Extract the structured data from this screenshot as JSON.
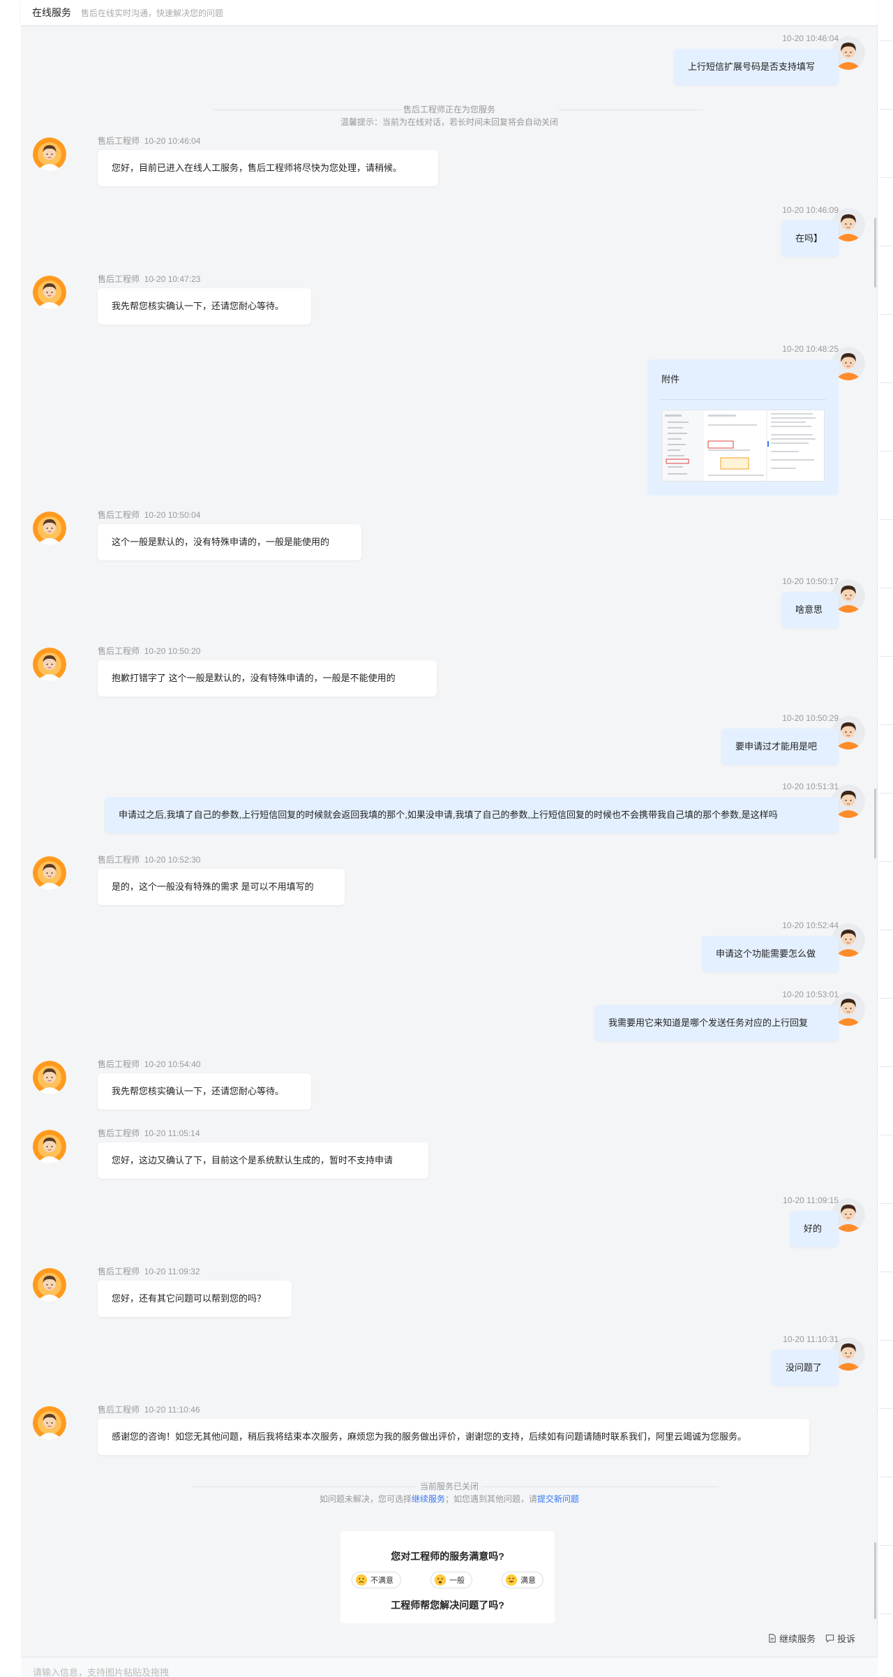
{
  "header": {
    "title": "在线服务",
    "subtitle": "售后在线实时沟通，快速解决您的问题"
  },
  "notices": {
    "start_title": "售后工程师正在为您服务",
    "start_tip": "温馨提示：当前为在线对话，若长时间未回复将会自动关闭",
    "closed_title": "当前服务已关闭",
    "closed_prefix": "如问题未解决，您可选择",
    "continue_link": "继续服务",
    "closed_mid": "；如您遇到其他问题，请",
    "new_issue_link": "提交新问题"
  },
  "agent_name": "售后工程师",
  "attachment_label": "附件",
  "messages": [
    {
      "who": "user",
      "time": "10-20 10:46:04",
      "text": "上行短信扩展号码是否支持填写"
    },
    {
      "who": "agent",
      "time": "10-20 10:46:04",
      "text": "您好，目前已进入在线人工服务，售后工程师将尽快为您处理，请稍候。"
    },
    {
      "who": "user",
      "time": "10-20 10:46:09",
      "text": "在吗】"
    },
    {
      "who": "agent",
      "time": "10-20 10:47:23",
      "text": "我先帮您核实确认一下，还请您耐心等待。"
    },
    {
      "who": "user",
      "time": "10-20 10:48:25",
      "text": ""
    },
    {
      "who": "agent",
      "time": "10-20 10:50:04",
      "text": "这个一般是默认的，没有特殊申请的，一般是能使用的"
    },
    {
      "who": "user",
      "time": "10-20 10:50:17",
      "text": "啥意思"
    },
    {
      "who": "agent",
      "time": "10-20 10:50:20",
      "text": "抱歉打错字了   这个一般是默认的，没有特殊申请的，一般是不能使用的"
    },
    {
      "who": "user",
      "time": "10-20 10:50:29",
      "text": "要申请过才能用是吧"
    },
    {
      "who": "user",
      "time": "10-20 10:51:31",
      "text": "申请过之后,我填了自己的参数,上行短信回复的时候就会返回我填的那个,如果没申请,我填了自己的参数,上行短信回复的时候也不会携带我自己填的那个参数,是这样吗"
    },
    {
      "who": "agent",
      "time": "10-20 10:52:30",
      "text": "是的，这个一般没有特殊的需求 是可以不用填写的"
    },
    {
      "who": "user",
      "time": "10-20 10:52:44",
      "text": "申请这个功能需要怎么做"
    },
    {
      "who": "user",
      "time": "10-20 10:53:01",
      "text": "我需要用它来知道是哪个发送任务对应的上行回复"
    },
    {
      "who": "agent",
      "time": "10-20 10:54:40",
      "text": "我先帮您核实确认一下，还请您耐心等待。"
    },
    {
      "who": "agent",
      "time": "10-20 11:05:14",
      "text": "您好，这边又确认了下，目前这个是系统默认生成的，暂时不支持申请"
    },
    {
      "who": "user",
      "time": "10-20 11:09:15",
      "text": "好的"
    },
    {
      "who": "agent",
      "time": "10-20 11:09:32",
      "text": "您好，还有其它问题可以帮到您的吗？"
    },
    {
      "who": "user",
      "time": "10-20 11:10:31",
      "text": "没问题了"
    },
    {
      "who": "agent",
      "time": "10-20 11:10:46",
      "text": "感谢您的咨询！如您无其他问题，稍后我将结束本次服务，麻烦您为我的服务做出评价，谢谢您的支持，后续如有问题请随时联系我们，阿里云竭诚为您服务。"
    }
  ],
  "rating": {
    "question": "您对工程师的服务满意吗?",
    "options": [
      "不满意",
      "一般",
      "满意"
    ],
    "question2": "工程师帮您解决问题了吗?"
  },
  "actions": {
    "continue": "继续服务",
    "complain": "投诉"
  },
  "input": {
    "placeholder": "请输入信息，支持图片粘贴及拖拽"
  }
}
